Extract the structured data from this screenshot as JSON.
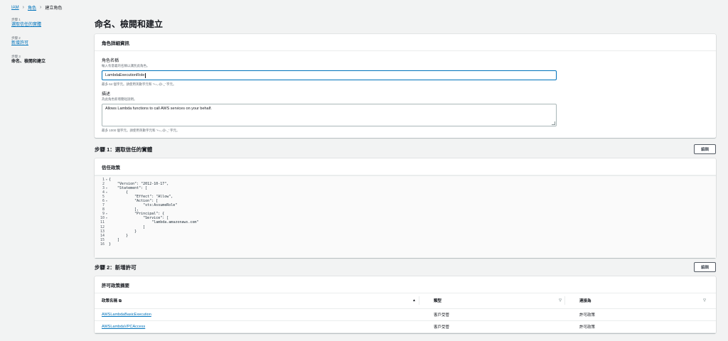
{
  "breadcrumb": {
    "iam": "IAM",
    "roles": "角色",
    "current": "建立角色"
  },
  "steps": [
    {
      "num": "步驟 1",
      "label": "選取信任的實體",
      "state": "link"
    },
    {
      "num": "步驟 2",
      "label": "新增許可",
      "state": "link"
    },
    {
      "num": "步驟 3",
      "label": "命名、檢閱和建立",
      "state": "active"
    }
  ],
  "page_title": "命名、檢閱和建立",
  "role_details": {
    "header": "角色詳細資訊",
    "name_label": "角色名稱",
    "name_desc": "輸入有意義的名稱以識別此角色。",
    "name_value": "LambdaExecutionRole",
    "name_hint": "最多 64 個字元。請使用英數字元和 '+=,.@-_' 字元。",
    "desc_label": "描述",
    "desc_desc": "為此角色新增簡短說明。",
    "desc_value": "Allows Lambda functions to call AWS services on your behalf.",
    "desc_hint": "最多 1000 個字元。請使用英數字元和 '+=,.@-_' 字元。"
  },
  "step1": {
    "title": "步驟 1：選取信任的實體",
    "edit": "編輯",
    "policy_header": "信任政策",
    "code_lines": [
      {
        "n": "1",
        "fold": "▾",
        "t": "{"
      },
      {
        "n": "2",
        "fold": "",
        "t": "    \"Version\": \"2012-10-17\","
      },
      {
        "n": "3",
        "fold": "▾",
        "t": "    \"Statement\": ["
      },
      {
        "n": "4",
        "fold": "▾",
        "t": "        {"
      },
      {
        "n": "5",
        "fold": "",
        "t": "            \"Effect\": \"Allow\","
      },
      {
        "n": "6",
        "fold": "▾",
        "t": "            \"Action\": ["
      },
      {
        "n": "7",
        "fold": "",
        "t": "                \"sts:AssumeRole\""
      },
      {
        "n": "8",
        "fold": "",
        "t": "            ],"
      },
      {
        "n": "9",
        "fold": "▾",
        "t": "            \"Principal\": {"
      },
      {
        "n": "10",
        "fold": "▾",
        "t": "                \"Service\": ["
      },
      {
        "n": "11",
        "fold": "",
        "t": "                    \"lambda.amazonaws.com\""
      },
      {
        "n": "12",
        "fold": "",
        "t": "                ]"
      },
      {
        "n": "13",
        "fold": "",
        "t": "            }"
      },
      {
        "n": "14",
        "fold": "",
        "t": "        }"
      },
      {
        "n": "15",
        "fold": "",
        "t": "    ]"
      },
      {
        "n": "16",
        "fold": "",
        "t": "}"
      }
    ]
  },
  "step2": {
    "title": "步驟 2：新增許可",
    "edit": "編輯",
    "summary_header": "許可政策摘要",
    "columns": [
      "政策名稱",
      "類型",
      "連接為"
    ],
    "rows": [
      {
        "name": "AWSLambdaBasicExecution",
        "type": "客戶受管",
        "attached": "許可政策"
      },
      {
        "name": "AWSLambdaVPCAccess",
        "type": "客戶受管",
        "attached": "許可政策"
      }
    ]
  },
  "colors": {
    "link": "#0073bb",
    "background": "#f2f3f3",
    "focus": "#0073bb"
  },
  "icons": {
    "external": "external-link-icon",
    "sort_asc": "sort-ascending-icon",
    "sort": "sort-icon",
    "separator": "chevron-right-icon"
  }
}
